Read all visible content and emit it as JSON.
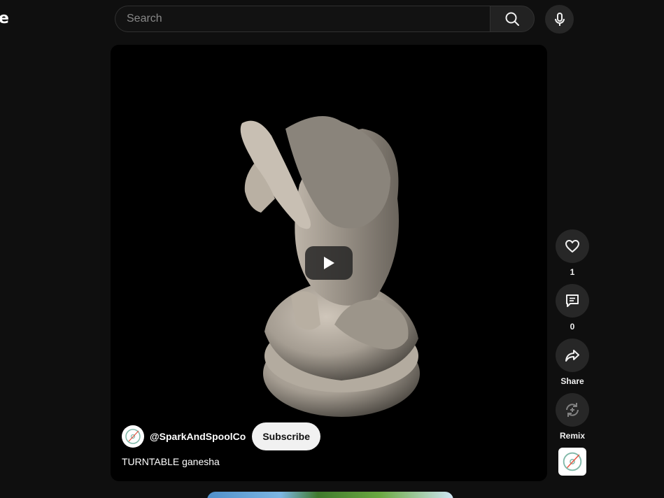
{
  "header": {
    "logo_fragment": "e",
    "search": {
      "placeholder": "Search",
      "value": ""
    }
  },
  "video": {
    "channel_handle": "@SparkAndSpoolCo",
    "subscribe_label": "Subscribe",
    "title": "TURNTABLE ganesha"
  },
  "actions": {
    "like_count": "1",
    "comment_count": "0",
    "share_label": "Share",
    "remix_label": "Remix"
  },
  "icons": {
    "search": "search-icon",
    "mic": "mic-icon",
    "play": "play-icon",
    "like": "heart-icon",
    "comment": "comment-icon",
    "share": "share-arrow-icon",
    "remix": "remix-icon"
  },
  "colors": {
    "background": "#0f0f0f",
    "button_bg": "#272727",
    "subscribe_bg": "#f1f1f1",
    "accent_avatar": "#e8533f"
  }
}
